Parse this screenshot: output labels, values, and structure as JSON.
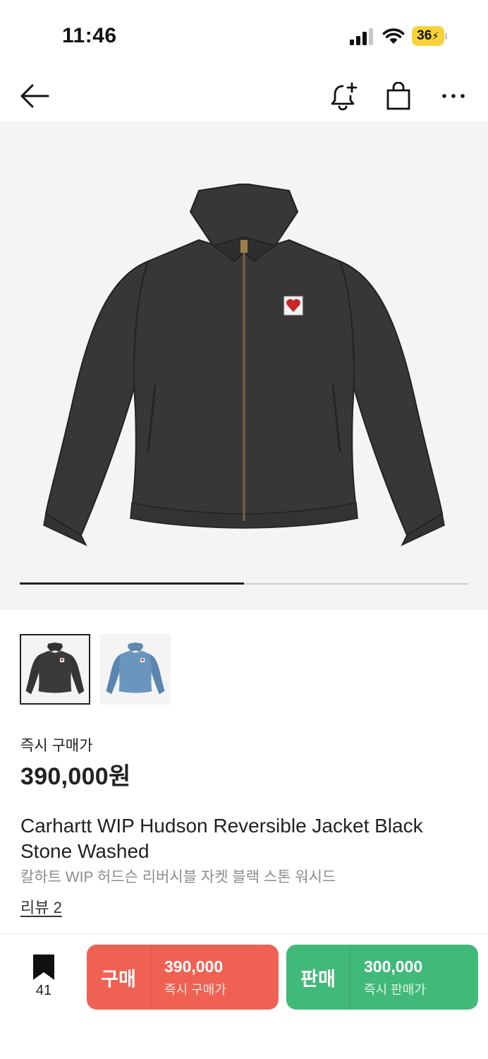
{
  "status_bar": {
    "time": "11:46",
    "battery": "36",
    "icons": [
      "signal-icon",
      "wifi-icon",
      "battery-charging-icon"
    ]
  },
  "nav": {
    "icons": [
      "back-arrow-icon",
      "bell-plus-icon",
      "shopping-bag-icon",
      "more-icon"
    ]
  },
  "gallery": {
    "image_position": 1,
    "image_count": 2,
    "progress_fraction": 0.5,
    "thumbnails": [
      {
        "color": "black",
        "selected": true
      },
      {
        "color": "blue",
        "selected": false
      }
    ]
  },
  "price": {
    "label": "즉시 구매가",
    "value": "390,000원"
  },
  "product": {
    "name_en": "Carhartt WIP Hudson Reversible Jacket Black Stone Washed",
    "name_ko": "칼하트 WIP 허드슨 리버시블 자켓 블랙 스톤 워시드",
    "review_link": "리뷰 2"
  },
  "bottom_bar": {
    "bookmark_count": "41",
    "buy": {
      "label": "구매",
      "price": "390,000",
      "sub": "즉시 구매가",
      "color": "#ef6253"
    },
    "sell": {
      "label": "판매",
      "price": "300,000",
      "sub": "즉시 판매가",
      "color": "#41b979"
    }
  }
}
